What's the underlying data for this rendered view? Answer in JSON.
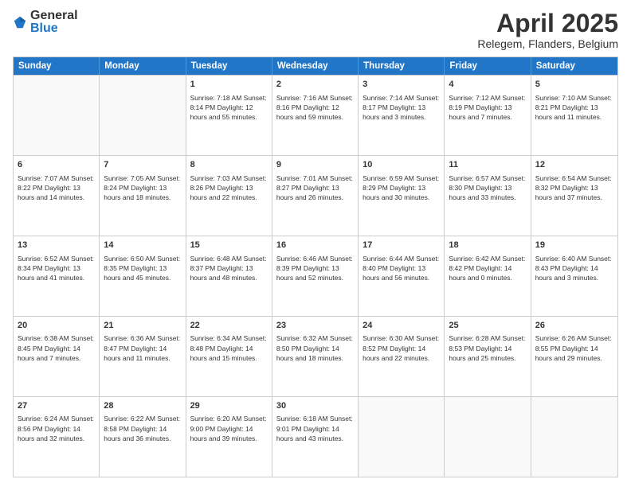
{
  "logo": {
    "general": "General",
    "blue": "Blue"
  },
  "title": "April 2025",
  "subtitle": "Relegem, Flanders, Belgium",
  "headers": [
    "Sunday",
    "Monday",
    "Tuesday",
    "Wednesday",
    "Thursday",
    "Friday",
    "Saturday"
  ],
  "weeks": [
    [
      {
        "day": "",
        "info": ""
      },
      {
        "day": "",
        "info": ""
      },
      {
        "day": "1",
        "info": "Sunrise: 7:18 AM\nSunset: 8:14 PM\nDaylight: 12 hours and 55 minutes."
      },
      {
        "day": "2",
        "info": "Sunrise: 7:16 AM\nSunset: 8:16 PM\nDaylight: 12 hours and 59 minutes."
      },
      {
        "day": "3",
        "info": "Sunrise: 7:14 AM\nSunset: 8:17 PM\nDaylight: 13 hours and 3 minutes."
      },
      {
        "day": "4",
        "info": "Sunrise: 7:12 AM\nSunset: 8:19 PM\nDaylight: 13 hours and 7 minutes."
      },
      {
        "day": "5",
        "info": "Sunrise: 7:10 AM\nSunset: 8:21 PM\nDaylight: 13 hours and 11 minutes."
      }
    ],
    [
      {
        "day": "6",
        "info": "Sunrise: 7:07 AM\nSunset: 8:22 PM\nDaylight: 13 hours and 14 minutes."
      },
      {
        "day": "7",
        "info": "Sunrise: 7:05 AM\nSunset: 8:24 PM\nDaylight: 13 hours and 18 minutes."
      },
      {
        "day": "8",
        "info": "Sunrise: 7:03 AM\nSunset: 8:26 PM\nDaylight: 13 hours and 22 minutes."
      },
      {
        "day": "9",
        "info": "Sunrise: 7:01 AM\nSunset: 8:27 PM\nDaylight: 13 hours and 26 minutes."
      },
      {
        "day": "10",
        "info": "Sunrise: 6:59 AM\nSunset: 8:29 PM\nDaylight: 13 hours and 30 minutes."
      },
      {
        "day": "11",
        "info": "Sunrise: 6:57 AM\nSunset: 8:30 PM\nDaylight: 13 hours and 33 minutes."
      },
      {
        "day": "12",
        "info": "Sunrise: 6:54 AM\nSunset: 8:32 PM\nDaylight: 13 hours and 37 minutes."
      }
    ],
    [
      {
        "day": "13",
        "info": "Sunrise: 6:52 AM\nSunset: 8:34 PM\nDaylight: 13 hours and 41 minutes."
      },
      {
        "day": "14",
        "info": "Sunrise: 6:50 AM\nSunset: 8:35 PM\nDaylight: 13 hours and 45 minutes."
      },
      {
        "day": "15",
        "info": "Sunrise: 6:48 AM\nSunset: 8:37 PM\nDaylight: 13 hours and 48 minutes."
      },
      {
        "day": "16",
        "info": "Sunrise: 6:46 AM\nSunset: 8:39 PM\nDaylight: 13 hours and 52 minutes."
      },
      {
        "day": "17",
        "info": "Sunrise: 6:44 AM\nSunset: 8:40 PM\nDaylight: 13 hours and 56 minutes."
      },
      {
        "day": "18",
        "info": "Sunrise: 6:42 AM\nSunset: 8:42 PM\nDaylight: 14 hours and 0 minutes."
      },
      {
        "day": "19",
        "info": "Sunrise: 6:40 AM\nSunset: 8:43 PM\nDaylight: 14 hours and 3 minutes."
      }
    ],
    [
      {
        "day": "20",
        "info": "Sunrise: 6:38 AM\nSunset: 8:45 PM\nDaylight: 14 hours and 7 minutes."
      },
      {
        "day": "21",
        "info": "Sunrise: 6:36 AM\nSunset: 8:47 PM\nDaylight: 14 hours and 11 minutes."
      },
      {
        "day": "22",
        "info": "Sunrise: 6:34 AM\nSunset: 8:48 PM\nDaylight: 14 hours and 15 minutes."
      },
      {
        "day": "23",
        "info": "Sunrise: 6:32 AM\nSunset: 8:50 PM\nDaylight: 14 hours and 18 minutes."
      },
      {
        "day": "24",
        "info": "Sunrise: 6:30 AM\nSunset: 8:52 PM\nDaylight: 14 hours and 22 minutes."
      },
      {
        "day": "25",
        "info": "Sunrise: 6:28 AM\nSunset: 8:53 PM\nDaylight: 14 hours and 25 minutes."
      },
      {
        "day": "26",
        "info": "Sunrise: 6:26 AM\nSunset: 8:55 PM\nDaylight: 14 hours and 29 minutes."
      }
    ],
    [
      {
        "day": "27",
        "info": "Sunrise: 6:24 AM\nSunset: 8:56 PM\nDaylight: 14 hours and 32 minutes."
      },
      {
        "day": "28",
        "info": "Sunrise: 6:22 AM\nSunset: 8:58 PM\nDaylight: 14 hours and 36 minutes."
      },
      {
        "day": "29",
        "info": "Sunrise: 6:20 AM\nSunset: 9:00 PM\nDaylight: 14 hours and 39 minutes."
      },
      {
        "day": "30",
        "info": "Sunrise: 6:18 AM\nSunset: 9:01 PM\nDaylight: 14 hours and 43 minutes."
      },
      {
        "day": "",
        "info": ""
      },
      {
        "day": "",
        "info": ""
      },
      {
        "day": "",
        "info": ""
      }
    ]
  ]
}
